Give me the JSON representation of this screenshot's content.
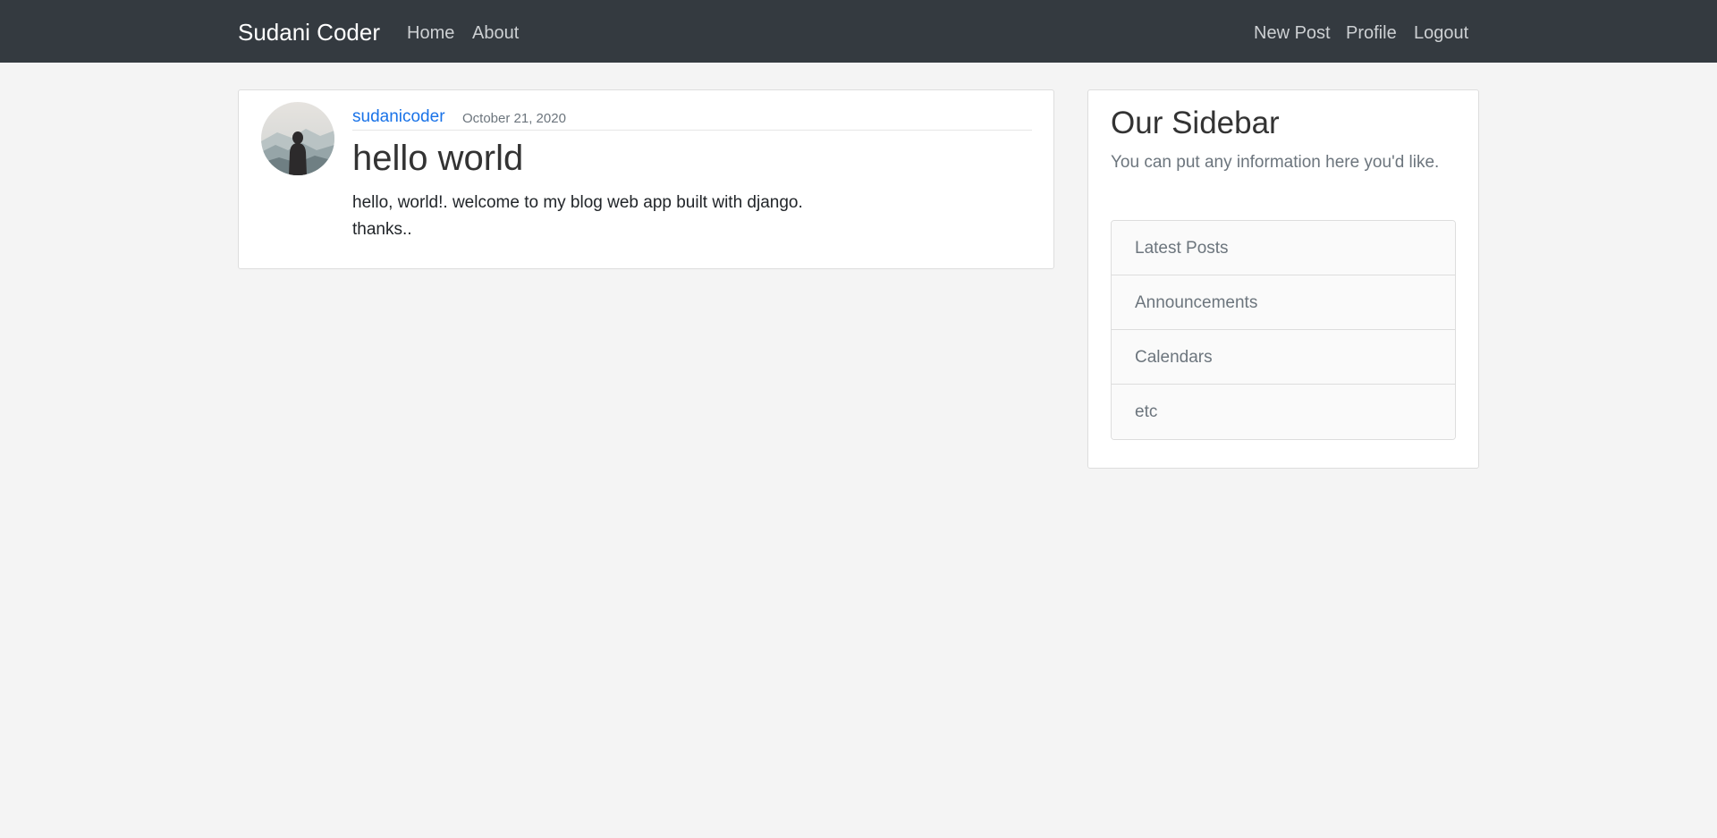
{
  "navbar": {
    "brand": "Sudani Coder",
    "left_links": [
      "Home",
      "About"
    ],
    "right_links": [
      "New Post",
      "Profile",
      "Logout"
    ]
  },
  "post": {
    "author": "sudanicoder",
    "date": "October 21, 2020",
    "title": "hello world",
    "content_lines": [
      "hello, world!. welcome to my blog web app built with django.",
      "thanks.."
    ]
  },
  "sidebar": {
    "title": "Our Sidebar",
    "text": "You can put any information here you'd like.",
    "items": [
      "Latest Posts",
      "Announcements",
      "Calendars",
      "etc"
    ]
  },
  "colors": {
    "navbar_bg": "#343a40",
    "page_bg": "#f4f4f4",
    "link_blue": "#1a73e8",
    "muted": "#6c757d"
  }
}
